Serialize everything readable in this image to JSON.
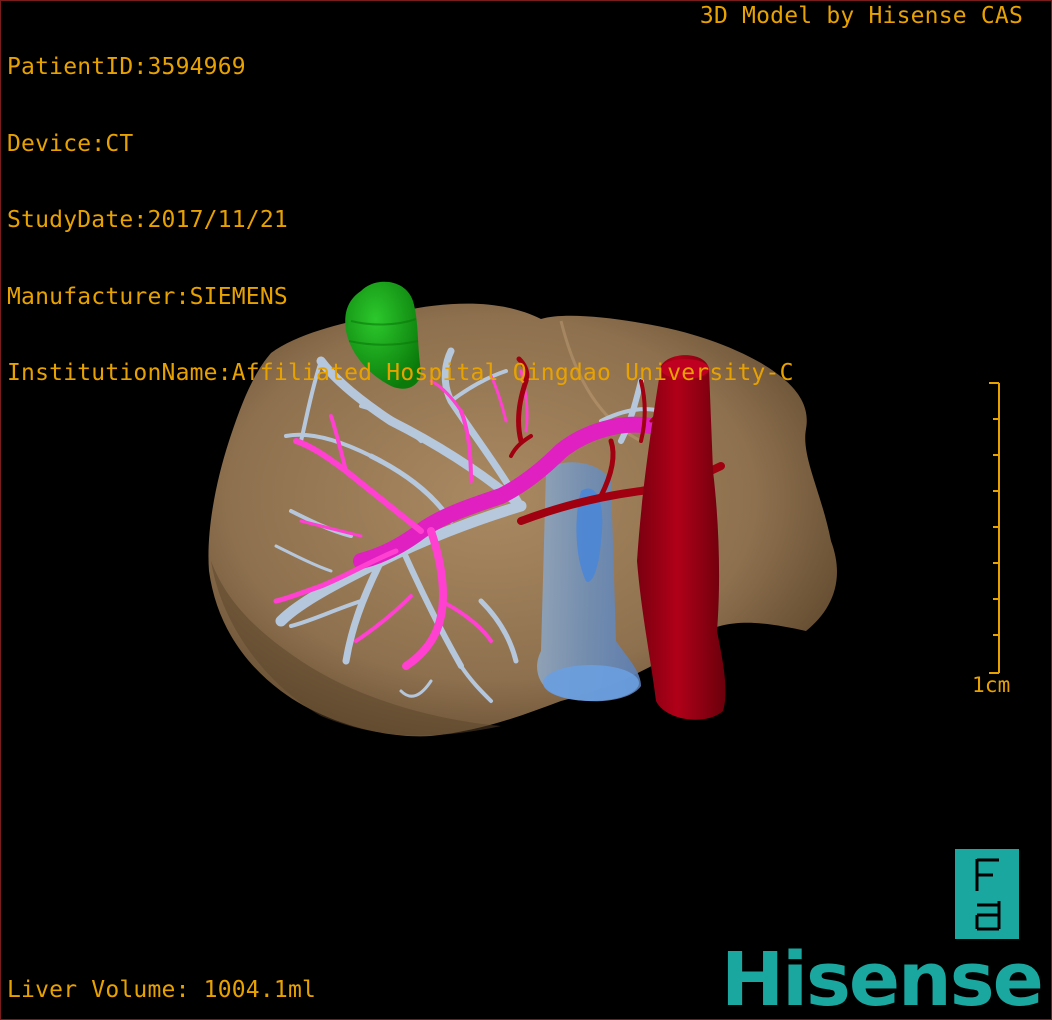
{
  "overlay": {
    "patient_id": "PatientID:3594969",
    "device": "Device:CT",
    "study_date": "StudyDate:2017/11/21",
    "manufacturer": "Manufacturer:SIEMENS",
    "institution": "InstitutionName:Affiliated Hospital Qingdao University-C",
    "model_credit": "3D Model by Hisense CAS",
    "liver_volume": "Liver Volume: 1004.1ml"
  },
  "scale_bar": {
    "label": "1cm"
  },
  "orientation_marker": {
    "icon": "orientation-cube-icon",
    "letters": [
      "F",
      "d"
    ]
  },
  "brand": {
    "logo_text": "Hisense"
  },
  "colors": {
    "overlay_text": "#e8a200",
    "liver": "#a07f5a",
    "hepatic_vein": "#b8cce4",
    "portal_vein": "#ff40d0",
    "artery": "#a00010",
    "ivc": "#5b8fd6",
    "gallbladder": "#14a014",
    "brand": "#1aa7a0"
  }
}
